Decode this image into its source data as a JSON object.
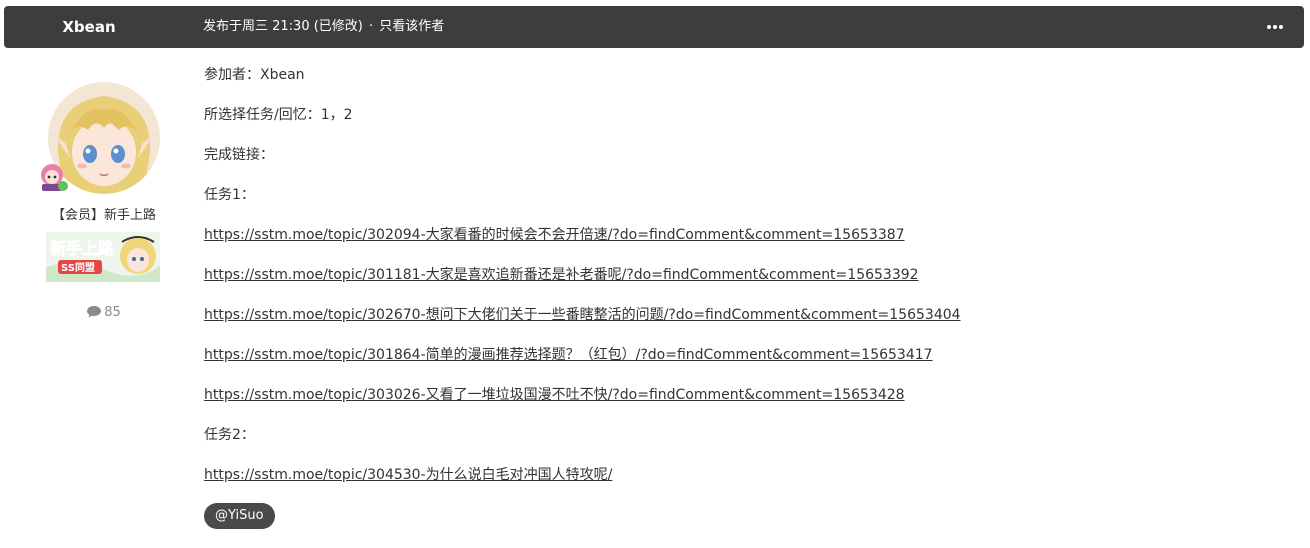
{
  "header": {
    "author": "Xbean",
    "posted_label": "发布于周三 21:30 (已修改)",
    "separator": "·",
    "only_author": "只看该作者"
  },
  "author_panel": {
    "member_group": "【会员】新手上路",
    "rank_badge_text": "新手上路",
    "rank_badge_subtext": "SS同盟",
    "post_count": "85"
  },
  "post": {
    "lines": [
      "参加者：Xbean",
      "所选择任务/回忆：1，2",
      "完成链接：",
      "任务1："
    ],
    "task1_links": [
      "https://sstm.moe/topic/302094-大家看番的时候会不会开倍速/?do=findComment&comment=15653387",
      "https://sstm.moe/topic/301181-大家是喜欢追新番还是补老番呢/?do=findComment&comment=15653392",
      "https://sstm.moe/topic/302670-想问下大佬们关于一些番瞎整活的问题/?do=findComment&comment=15653404",
      "https://sstm.moe/topic/301864-简单的漫画推荐选择题？（红包）/?do=findComment&comment=15653417",
      "https://sstm.moe/topic/303026-又看了一堆垃圾国漫不吐不快/?do=findComment&comment=15653428"
    ],
    "task2_label": "任务2：",
    "task2_links": [
      "https://sstm.moe/topic/304530-为什么说白毛对冲国人特攻呢/"
    ],
    "mention": "@YiSuo"
  },
  "colors": {
    "header_bg": "#3d3d3d",
    "mention_bg": "#4a4a4a"
  }
}
